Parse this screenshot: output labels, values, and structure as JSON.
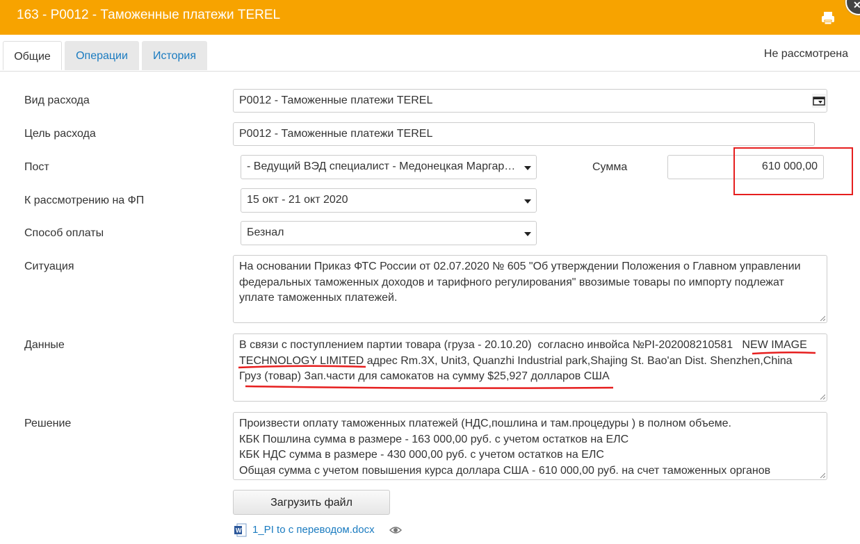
{
  "window": {
    "title": "163 - P0012 - Таможенные платежи TEREL"
  },
  "tabs": [
    {
      "label": "Общие"
    },
    {
      "label": "Операции"
    },
    {
      "label": "История"
    }
  ],
  "status": "Не рассмотрена",
  "form": {
    "expense_type": {
      "label": "Вид расхода",
      "value": "P0012 - Таможенные платежи TEREL"
    },
    "expense_purpose": {
      "label": "Цель расхода",
      "value": "P0012 - Таможенные платежи TEREL"
    },
    "post": {
      "label": "Пост",
      "value": "- Ведущий ВЭД специалист - Медонецкая Маргарита"
    },
    "amount": {
      "label": "Сумма",
      "value": "610 000,00"
    },
    "fp_review": {
      "label": "К рассмотрению на ФП",
      "value": "15 окт - 21 окт 2020"
    },
    "payment_method": {
      "label": "Способ оплаты",
      "value": "Безнал"
    },
    "situation": {
      "label": "Ситуация",
      "lines": [
        "На основании Приказ ФТС России от 02.07.2020 № 605 \"Об утверждении Положения о Главном управлении",
        "федеральных таможенных доходов и тарифного регулирования\" ввозимые товары по импорту подлежат",
        "уплате таможенных платежей."
      ]
    },
    "data": {
      "label": "Данные",
      "lines": [
        "В связи с поступлением партии товара (груза - 20.10.20)  согласно инвойса №PI-202008210581   NEW IMAGE",
        "TECHNOLOGY LIMITED адрес Rm.3X, Unit3, Quanzhi Industrial park,Shajing St. Bao'an Dist. Shenzhen,China",
        "Груз (товар) Зап.части для самокатов на сумму $25,927 долларов США"
      ]
    },
    "decision": {
      "label": "Решение",
      "lines": [
        "Произвести оплату таможенных платежей (НДС,пошлина и там.процедуры ) в полном объеме.",
        "КБК Пошлина сумма в размере - 163 000,00 руб. с учетом остатков на ЕЛС",
        "КБК НДС сумма в размере - 430 000,00 руб. с учетом остатков на ЕЛС",
        "Общая сумма с учетом повышения курса доллара США - 610 000,00 руб. на счет таможенных органов"
      ]
    }
  },
  "upload_button": "Загрузить файл",
  "attachment": {
    "filename": "1_PI to с переводом.docx"
  },
  "icons": {
    "print": "printer-icon",
    "close": "close-icon",
    "picker": "dropdown-list-icon",
    "doc": "word-doc-icon",
    "view": "eye-icon"
  },
  "colors": {
    "titlebar": "#f7a300",
    "link": "#1a7bc0",
    "annotation": "#e61e1e"
  }
}
